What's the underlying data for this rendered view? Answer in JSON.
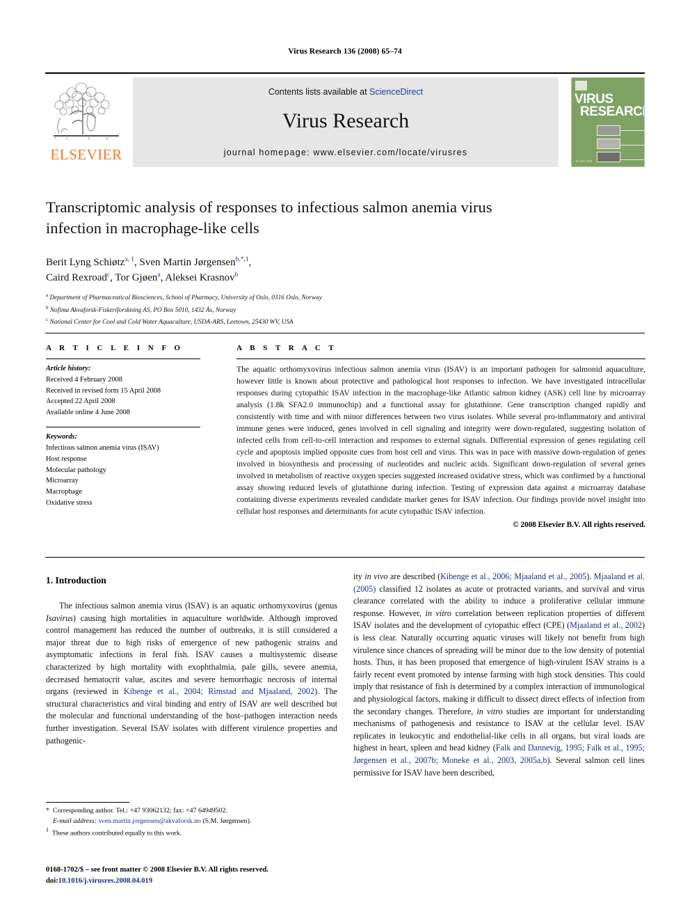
{
  "running_head": "Virus Research 136 (2008) 65–74",
  "masthead": {
    "publisher_name": "ELSEVIER",
    "contents_prefix": "Contents lists available at ",
    "contents_link": "ScienceDirect",
    "journal_name": "Virus Research",
    "homepage": "journal homepage: www.elsevier.com/locate/virusres",
    "cover": {
      "title_line1": "VIRUS",
      "title_line2": "RESEARCH",
      "footer": "ELSEVIER"
    }
  },
  "article": {
    "title": "Transcriptomic analysis of responses to infectious salmon anemia virus infection in macrophage-like cells",
    "affiliations": [
      {
        "marker": "a",
        "text": "Department of Pharmaceutical Biosciences, School of Pharmacy, University of Oslo, 0316 Oslo, Norway"
      },
      {
        "marker": "b",
        "text": "Nofima Akvaforsk-Fiskeriforskning AS, PO Box 5010, 1432 Ås, Norway"
      },
      {
        "marker": "c",
        "text": "National Center for Cool and Cold Water Aquaculture, USDA-ARS, Leetown, 25430 WV, USA"
      }
    ]
  },
  "info": {
    "heading": "A R T I C L E   I N F O",
    "history_label": "Article history:",
    "history": [
      "Received 4 February 2008",
      "Received in revised form 15 April 2008",
      "Accepted 22 April 2008",
      "Available online 4 June 2008"
    ],
    "keywords_label": "Keywords:",
    "keywords": [
      "Infectious salmon anemia virus (ISAV)",
      "Host response",
      "Molecular pathology",
      "Microarray",
      "Macrophage",
      "Oxidative stress"
    ]
  },
  "abstract": {
    "heading": "A B S T R A C T",
    "copyright": "© 2008 Elsevier B.V. All rights reserved."
  },
  "body": {
    "section_heading": "1.  Introduction"
  },
  "footnotes": {
    "corresponding": "Corresponding author. Tel.: +47 93062132; fax: +47 64949502.",
    "email_label": "E-mail address:",
    "email": "sven.martin.jorgensen@akvaforsk.no",
    "email_suffix": "(S.M. Jørgensen).",
    "equal_contrib": "These authors contributed equally to this work.",
    "issn_line": "0168-1702/$ – see front matter © 2008 Elsevier B.V. All rights reserved.",
    "doi_label": "doi:",
    "doi": "10.1016/j.virusres.2008.04.019"
  },
  "colors": {
    "link": "#1a3fa0",
    "citation": "#1a2f80",
    "elsevier_orange": "#EE7722",
    "cover_green": "#7ea264",
    "banner_gray": "#e6e6e6"
  }
}
